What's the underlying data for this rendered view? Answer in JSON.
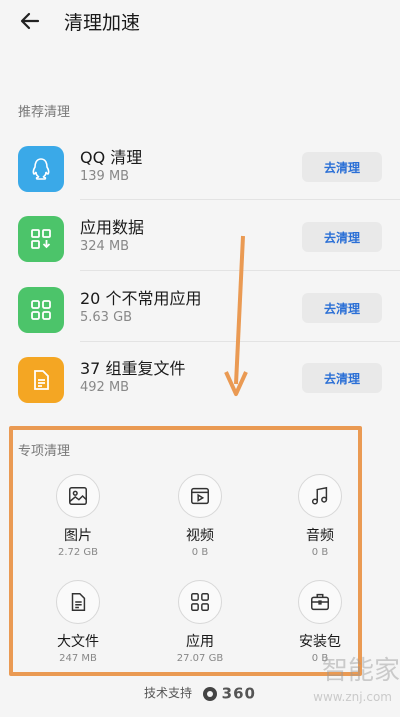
{
  "header": {
    "title": "清理加速"
  },
  "recommend": {
    "label": "推荐清理",
    "items": [
      {
        "name": "QQ 清理",
        "size": "139 MB",
        "button": "去清理",
        "icon": "qq-icon",
        "color": "#3aa9e8"
      },
      {
        "name": "应用数据",
        "size": "324 MB",
        "button": "去清理",
        "icon": "app-data-icon",
        "color": "#4cc46a"
      },
      {
        "name": "20 个不常用应用",
        "size": "5.63 GB",
        "button": "去清理",
        "icon": "apps-grid-icon",
        "color": "#4cc46a"
      },
      {
        "name": "37 组重复文件",
        "size": "492 MB",
        "button": "去清理",
        "icon": "duplicate-file-icon",
        "color": "#f4a623"
      }
    ]
  },
  "special": {
    "label": "专项清理",
    "items": [
      {
        "name": "图片",
        "size": "2.72 GB",
        "icon": "image-icon"
      },
      {
        "name": "视频",
        "size": "0 B",
        "icon": "video-icon"
      },
      {
        "name": "音频",
        "size": "0 B",
        "icon": "music-icon"
      },
      {
        "name": "大文件",
        "size": "247 MB",
        "icon": "document-icon"
      },
      {
        "name": "应用",
        "size": "27.07 GB",
        "icon": "apps-grid-icon"
      },
      {
        "name": "安装包",
        "size": "0 B",
        "icon": "package-icon"
      }
    ]
  },
  "footer": {
    "text": "技术支持",
    "brand": "360"
  },
  "watermark": {
    "text": "智能家",
    "url": "www.znj.com"
  },
  "colors": {
    "accent_button_text": "#2a6fd6",
    "annotation_orange": "#ea9a53"
  }
}
